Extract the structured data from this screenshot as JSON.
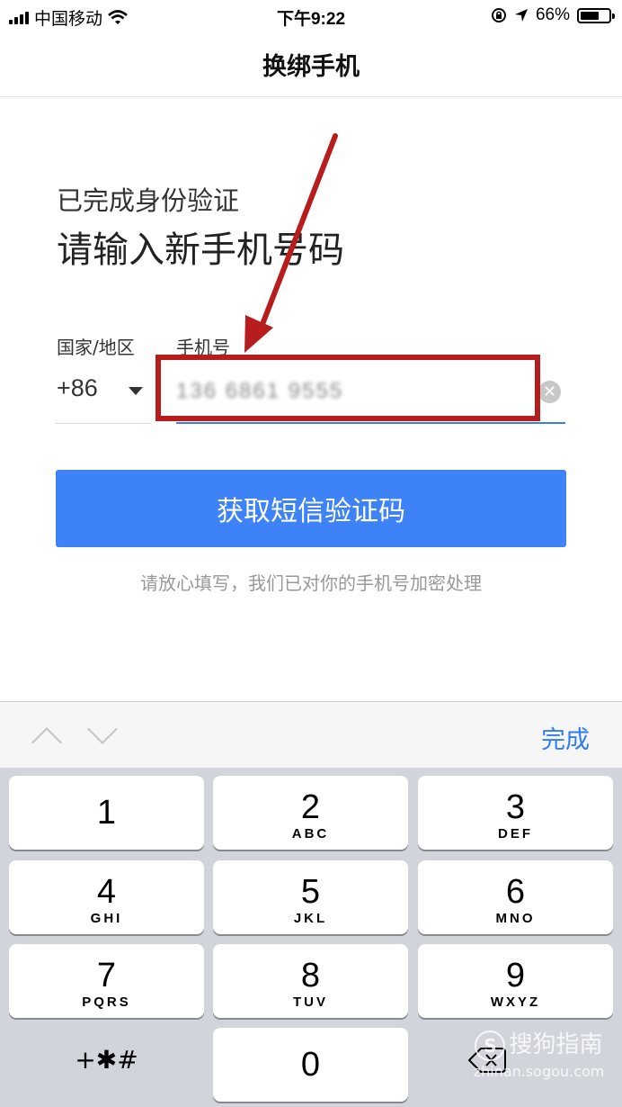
{
  "status_bar": {
    "carrier": "中国移动",
    "time": "下午9:22",
    "battery_percent": "66%",
    "battery_level": 0.66
  },
  "nav": {
    "title": "换绑手机"
  },
  "form": {
    "subtitle": "已完成身份验证",
    "headline": "请输入新手机号码",
    "country_label": "国家/地区",
    "phone_label": "手机号",
    "country_code": "+86",
    "phone_value": "136 6861 9555",
    "submit_label": "获取短信验证码",
    "privacy_note": "请放心填写，我们已对你的手机号加密处理"
  },
  "keyboard": {
    "done_label": "完成",
    "keys": [
      {
        "digit": "1",
        "letters": ""
      },
      {
        "digit": "2",
        "letters": "ABC"
      },
      {
        "digit": "3",
        "letters": "DEF"
      },
      {
        "digit": "4",
        "letters": "GHI"
      },
      {
        "digit": "5",
        "letters": "JKL"
      },
      {
        "digit": "6",
        "letters": "MNO"
      },
      {
        "digit": "7",
        "letters": "PQRS"
      },
      {
        "digit": "8",
        "letters": "TUV"
      },
      {
        "digit": "9",
        "letters": "WXYZ"
      },
      {
        "digit": "0",
        "letters": ""
      }
    ],
    "symbols_label": "+✱#"
  },
  "watermark": {
    "brand": "搜狗指南",
    "url": "zhinan.sogou.com"
  },
  "colors": {
    "accent": "#3e82f7",
    "highlight": "#b81d1d",
    "keyboard_bg": "#d1d4da"
  },
  "icons": [
    "signal-icon",
    "wifi-icon",
    "rotation-lock-icon",
    "location-icon",
    "battery-icon",
    "dropdown-caret-icon",
    "clear-icon",
    "chevron-up-icon",
    "chevron-down-icon",
    "backspace-icon"
  ]
}
